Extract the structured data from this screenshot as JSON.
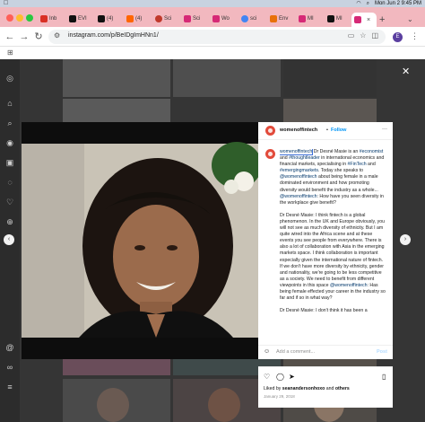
{
  "menubar": {
    "apple_icon": "apple-icon",
    "date_time": "Mon Jun 2  9:45 PM"
  },
  "tabs": [
    {
      "label": "Inb",
      "color": "#d93025"
    },
    {
      "label": "EVI",
      "color": "#111111"
    },
    {
      "label": "(4)",
      "color": "#111111"
    },
    {
      "label": "(4)",
      "color": "#ff6600"
    },
    {
      "label": "Sci",
      "color": "#c0392b"
    },
    {
      "label": "Sci",
      "color": "#d62976"
    },
    {
      "label": "Wo",
      "color": "#d62976"
    },
    {
      "label": "sci",
      "color": "#4285f4"
    },
    {
      "label": "Env",
      "color": "#e8710a"
    },
    {
      "label": "MI",
      "color": "#d62976"
    },
    {
      "label": "MI",
      "color": "#111111"
    },
    {
      "label": "",
      "color": "#d62976",
      "active": true
    }
  ],
  "toolbar": {
    "url": "instagram.com/p/BeIDgImHNn1/",
    "profile_initial": "E"
  },
  "post": {
    "username": "womenoffintech",
    "follow_label": "Follow",
    "dot": "•",
    "more": "···",
    "caption": {
      "mention_start": "womenoffintech",
      "p1_a": " Dr Desné Masie is an ",
      "h_economist": "#economist",
      "p1_b": " and ",
      "h_thoughtleader": "#thoughtleader",
      "p1_c": " in international economics and financial markets, specialising in ",
      "h_fintech": "#FinTech",
      "p1_d": " and ",
      "h_emerging": "#emergingmarkets",
      "p1_e": ". Today she speaks to ",
      "mention_2": "@womenoffintech",
      "p1_f": " about being female in a male dominated environment and how promoting diversity would benefit the industry as a whole... ",
      "mention_3": "@womenoffintech",
      "p1_g": ": How have you seen diversity in the workplace give benefit?",
      "p2": "Dr Desné Masie: I think fintech is a global phenomenon. In the UK and Europe obviously, you will not see as much diversity of ethnicity. But I am quite wired into the Africa scene and at these events you see people from everywhere. There is also a lot of collaboration with Asia in the emerging markets space. I think collaboration is important especially given the international nature of fintech. If we don't have more diversity by ethnicity, gender and nationality, we're going to be less competitive as a society. We need to benefit from different viewpoints in this space ",
      "mention_4": "@womenoffintech",
      "p2_b": ": Has being female effected your career in the industry so far and if so in what way?",
      "p3": "Dr Desné Masie: I don't think it has been a"
    },
    "liked_by_prefix": "Liked by ",
    "liked_by_user": "seanandersonhoxo",
    "liked_by_and": " and ",
    "liked_by_others": "others",
    "date": "January 29, 2018",
    "comment_placeholder": "Add a comment...",
    "post_label": "Post"
  },
  "colors": {
    "menubar": "#c8d2e0",
    "tabstrip": "#f2b8bf",
    "follow": "#0095f6",
    "hashtag": "#00376b",
    "brand": "#e24b3b"
  }
}
